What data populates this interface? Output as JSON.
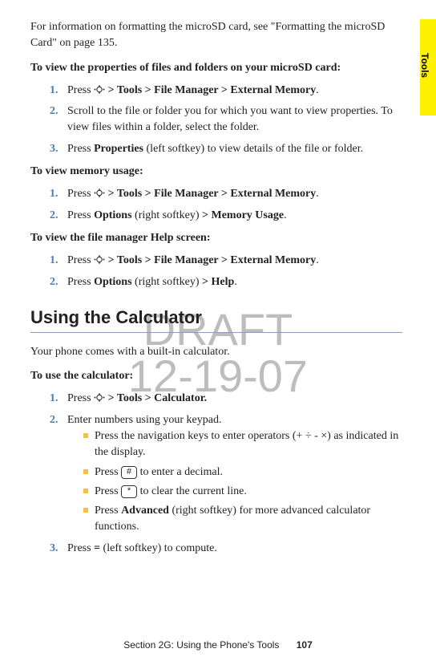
{
  "watermark_line1": "DRAFT",
  "watermark_line2": "12-19-07",
  "side_tab": "Tools",
  "intro": "For information on formatting the microSD card, see \"Formatting the microSD Card\" on page 135.",
  "block1": {
    "heading": "To view the properties of files and folders on your microSD card:",
    "steps": [
      {
        "n": "1.",
        "pre": "Press ",
        "nav": true,
        "post": " > Tools > File Manager > External Memory",
        "tail": "."
      },
      {
        "n": "2.",
        "text": "Scroll to the file or folder you for which you want to view properties. To view files within a folder, select the folder."
      },
      {
        "n": "3.",
        "pre": "Press ",
        "bold1": "Properties",
        "mid": " (left softkey) to view details of the file or folder."
      }
    ]
  },
  "block2": {
    "heading": "To view memory usage:",
    "steps": [
      {
        "n": "1.",
        "pre": "Press ",
        "nav": true,
        "post": " > Tools > File Manager > External Memory",
        "tail": "."
      },
      {
        "n": "2.",
        "pre": "Press ",
        "bold1": "Options",
        "mid": " (right softkey) ",
        "bold2": "> Memory Usage",
        "tail": "."
      }
    ]
  },
  "block3": {
    "heading": "To view the file manager Help screen:",
    "steps": [
      {
        "n": "1.",
        "pre": "Press ",
        "nav": true,
        "post": " > Tools > File Manager > External Memory",
        "tail": "."
      },
      {
        "n": "2.",
        "pre": "Press ",
        "bold1": "Options",
        "mid": " (right softkey) ",
        "bold2": "> Help",
        "tail": "."
      }
    ]
  },
  "section_title": "Using the Calculator",
  "calc_intro": "Your phone comes with a built-in calculator.",
  "calc_block": {
    "heading": "To use the calculator:",
    "step1": {
      "n": "1.",
      "pre": "Press ",
      "nav": true,
      "post": " > Tools > Calculator."
    },
    "step2": {
      "n": "2.",
      "text": "Enter numbers using your keypad."
    },
    "sub": [
      {
        "text": "Press the navigation keys to enter operators (+ ÷ - ×) as indicated in the display."
      },
      {
        "pre": "Press ",
        "key": "#",
        "post": " to enter a decimal."
      },
      {
        "pre": "Press ",
        "key": "*",
        "post": " to clear the current line."
      },
      {
        "pre": "Press ",
        "bold": "Advanced",
        "post": " (right softkey) for more advanced calculator functions."
      }
    ],
    "step3": {
      "n": "3.",
      "pre": "Press ",
      "bold": "=",
      "post": " (left softkey) to compute."
    }
  },
  "footer_text": "Section 2G: Using the Phone's Tools",
  "footer_page": "107"
}
